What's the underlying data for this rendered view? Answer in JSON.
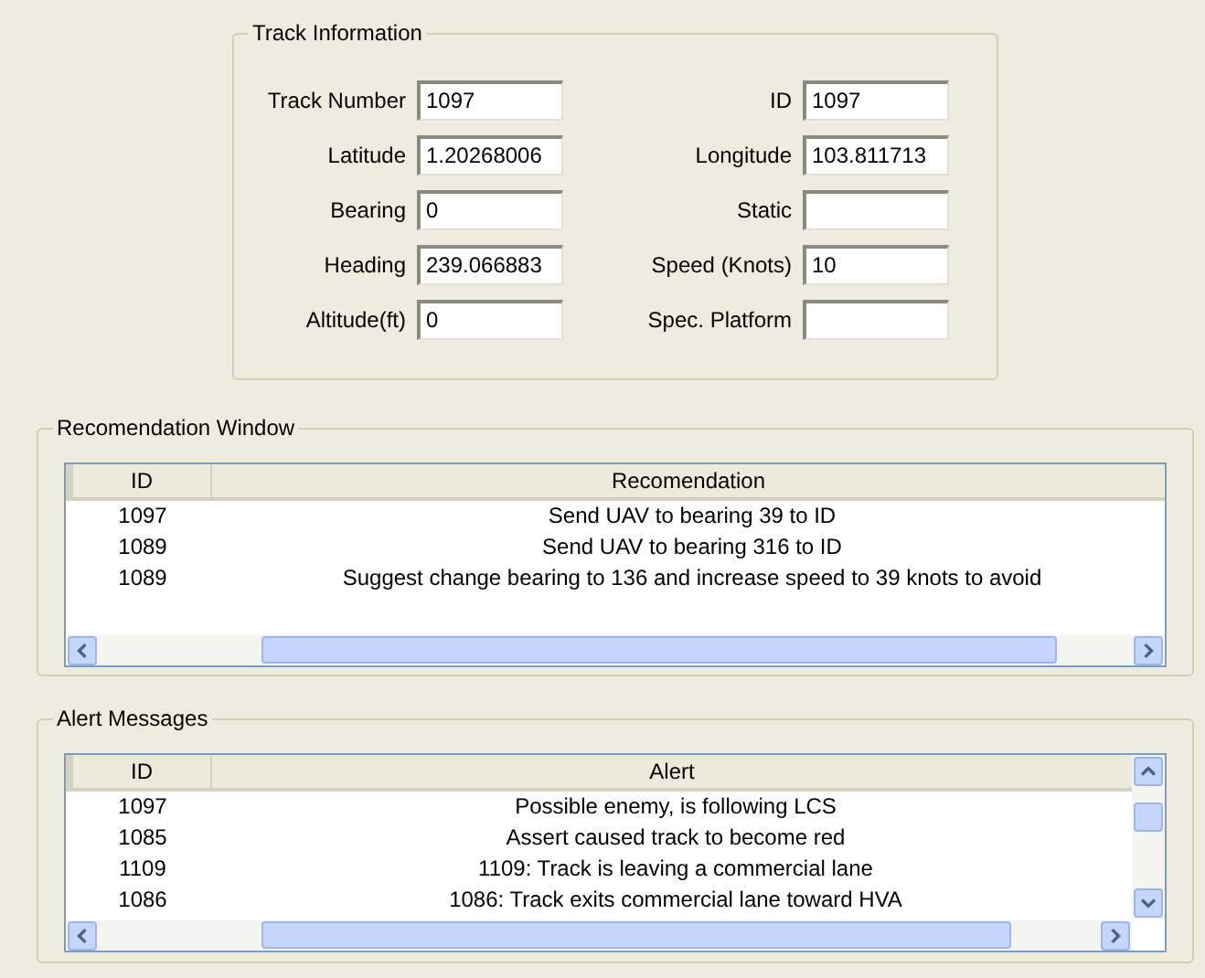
{
  "track_information": {
    "title": "Track Information",
    "left_fields": [
      {
        "label": "Track Number",
        "value": "1097"
      },
      {
        "label": "Latitude",
        "value": "1.20268006"
      },
      {
        "label": "Bearing",
        "value": "0"
      },
      {
        "label": "Heading",
        "value": "239.066883"
      },
      {
        "label": "Altitude(ft)",
        "value": "0"
      }
    ],
    "right_fields": [
      {
        "label": "ID",
        "value": "1097"
      },
      {
        "label": "Longitude",
        "value": "103.811713"
      },
      {
        "label": "Static"
      },
      {
        "label": "Speed (Knots)",
        "value": "10"
      },
      {
        "label": "Spec. Platform"
      }
    ]
  },
  "recommendation_window": {
    "title": "Recomendation Window",
    "columns": [
      "ID",
      "Recomendation"
    ],
    "rows": [
      [
        "1097",
        "Send UAV to bearing 39 to ID"
      ],
      [
        "1089",
        "Send UAV to bearing 316 to ID"
      ],
      [
        "1089",
        "Suggest change bearing to 136 and increase speed to 39 knots to avoid"
      ]
    ]
  },
  "alert_messages": {
    "title": "Alert Messages",
    "columns": [
      "ID",
      "Alert"
    ],
    "rows": [
      [
        "1097",
        "Possible enemy, is following LCS"
      ],
      [
        "1085",
        "Assert caused track to become red"
      ],
      [
        "1109",
        "1109: Track is leaving a commercial lane"
      ],
      [
        "1086",
        "1086: Track exits commercial lane toward HVA"
      ]
    ]
  }
}
